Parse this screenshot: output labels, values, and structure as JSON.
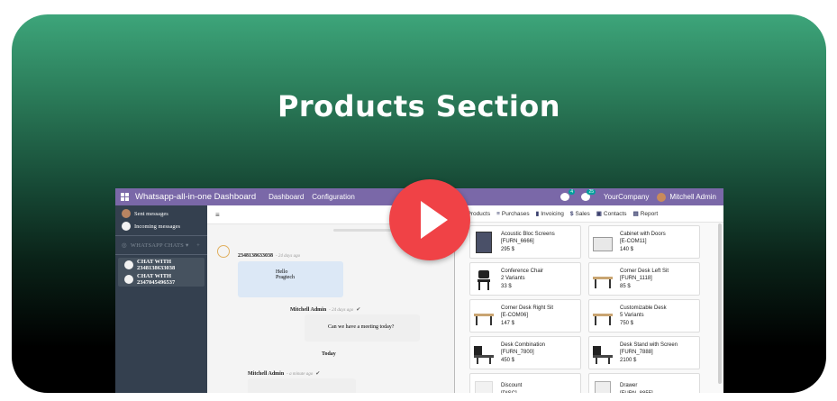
{
  "headline": "Products Section",
  "colors": {
    "brand_bar": "#7a68a8",
    "play": "#f04246",
    "sidebar": "#34404f",
    "gradient_top": "#3da57a"
  },
  "topbar": {
    "app_title": "Whatsapp-all-in-one Dashboard",
    "menu": [
      "Dashboard",
      "Configuration"
    ],
    "chat_badge": "4",
    "activity_badge": "25",
    "company": "YourCompany",
    "user": "Mitchell Admin"
  },
  "sidebar": {
    "sent": "Sent messages",
    "incoming": "Incoming messages",
    "chats_header": "WHATSAPP CHATS",
    "plus": "+",
    "chats": [
      "CHAT WITH 2348138633038",
      "CHAT WITH 2347045496537"
    ]
  },
  "chat": {
    "header_partial": "Cl",
    "messages": [
      {
        "sender": "2348138633038",
        "time": "- 24 days ago",
        "lines": [
          "Hello",
          "Pragtech"
        ]
      },
      {
        "sender": "Mitchell Admin",
        "time": "- 24 days ago",
        "lines": [
          "Can we have a meeting today?"
        ]
      },
      {
        "sender": "Mitchell Admin",
        "time": "- a minute ago",
        "lines": []
      }
    ],
    "day_divider": "Today"
  },
  "products_panel": {
    "tabs": [
      {
        "label": "Products",
        "icon": "cart-icon"
      },
      {
        "label": "Purchases",
        "icon": "list-icon"
      },
      {
        "label": "Invoicing",
        "icon": "book-icon"
      },
      {
        "label": "Sales",
        "icon": "dollar-icon"
      },
      {
        "label": "Contacts",
        "icon": "contact-icon"
      },
      {
        "label": "Report",
        "icon": "report-icon"
      }
    ],
    "items": [
      {
        "name": "Acoustic Bloc Screens",
        "code": "[FURN_6666]",
        "price": "295 $",
        "icon": "screen-icon"
      },
      {
        "name": "Cabinet with Doors",
        "code": "[E-COM11]",
        "price": "140 $",
        "icon": "cabinet-icon"
      },
      {
        "name": "Conference Chair",
        "code": "2 Variants",
        "price": "33 $",
        "icon": "chair-icon"
      },
      {
        "name": "Corner Desk Left Sit",
        "code": "[FURN_1118]",
        "price": "85 $",
        "icon": "desk-icon"
      },
      {
        "name": "Corner Desk Right Sit",
        "code": "[E-COM06]",
        "price": "147 $",
        "icon": "desk-icon"
      },
      {
        "name": "Customizable Desk",
        "code": "5 Variants",
        "price": "750 $",
        "icon": "desk-icon"
      },
      {
        "name": "Desk Combination",
        "code": "[FURN_7800]",
        "price": "450 $",
        "icon": "desk-combo-icon"
      },
      {
        "name": "Desk Stand with Screen",
        "code": "[FURN_7888]",
        "price": "2100 $",
        "icon": "desk-combo-icon"
      },
      {
        "name": "Discount",
        "code": "[DISC]",
        "price": "",
        "icon": "placeholder-icon"
      },
      {
        "name": "Drawer",
        "code": "[FURN_8855]",
        "price": "",
        "icon": "drawer-icon"
      }
    ]
  }
}
